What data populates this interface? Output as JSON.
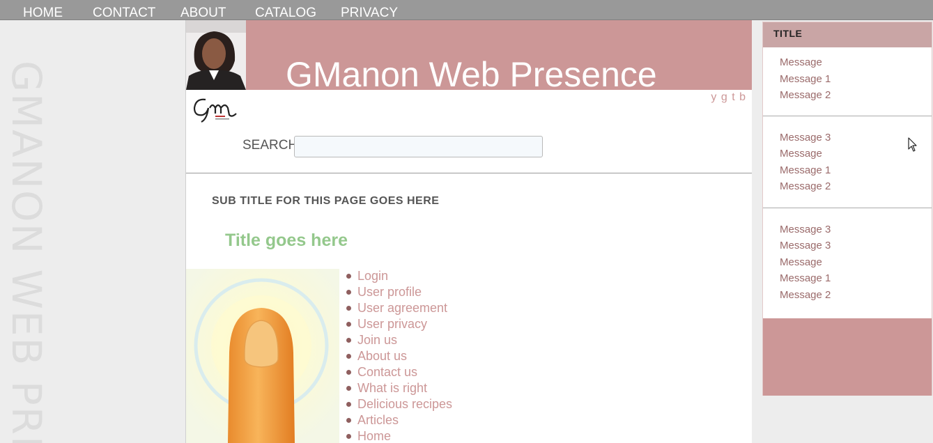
{
  "nav": {
    "items": [
      {
        "label": "HOME"
      },
      {
        "label": "CONTACT"
      },
      {
        "label": "ABOUT"
      },
      {
        "label": "CATALOG"
      },
      {
        "label": "PRIVACY"
      }
    ]
  },
  "watermark": {
    "text": "GMANON WEB PRE"
  },
  "header": {
    "title": "GManon Web Presence",
    "social_links": "y g t b"
  },
  "search": {
    "label": "SEARCH:",
    "value": "",
    "placeholder": ""
  },
  "main": {
    "subtitle": "SUB TITLE FOR THIS PAGE GOES HERE",
    "title": "Title goes here",
    "links": [
      {
        "label": "Login"
      },
      {
        "label": "User profile"
      },
      {
        "label": "User agreement"
      },
      {
        "label": "User privacy"
      },
      {
        "label": "Join us"
      },
      {
        "label": "About us"
      },
      {
        "label": "Contact us"
      },
      {
        "label": "What is right"
      },
      {
        "label": "Delicious recipes"
      },
      {
        "label": "Articles"
      },
      {
        "label": "Home"
      }
    ]
  },
  "sidebar": {
    "title": "TITLE",
    "groups": [
      {
        "messages": [
          "Message",
          "Message 1",
          "Message 2"
        ]
      },
      {
        "messages": [
          "Message 3",
          "Message",
          "Message 1",
          "Message 2"
        ]
      },
      {
        "messages": [
          "Message 3",
          "Message 3",
          "Message",
          "Message 1",
          "Message 2"
        ]
      }
    ]
  },
  "colors": {
    "accent": "#cc9797",
    "nav_bg": "#999999",
    "title_green": "#94c88c",
    "link": "#cc9797"
  },
  "icons": {
    "logo": "gm-logo",
    "avatar": "avatar-photo",
    "hero": "finger-glow-image",
    "cursor": "mouse-cursor-icon"
  }
}
